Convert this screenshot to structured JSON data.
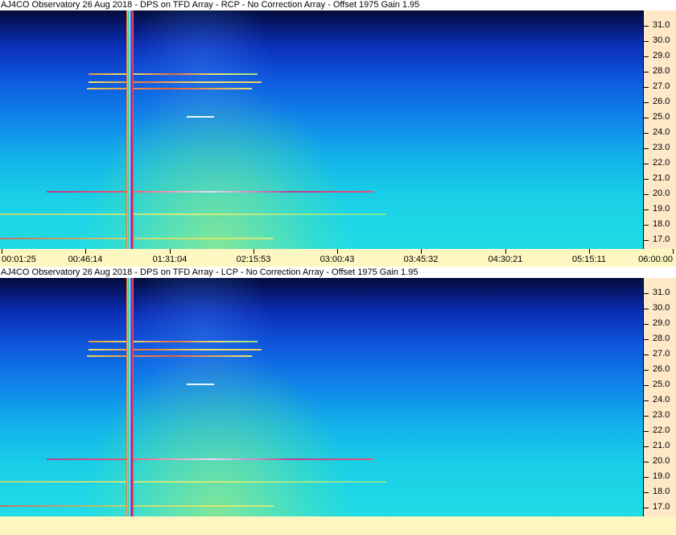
{
  "panels": [
    {
      "title": "AJ4CO Observatory 26 Aug 2018 - DPS on TFD Array  - RCP  -  No Correction Array  -  Offset 1975  Gain 1.95",
      "freq_labels": [
        "31.0",
        "30.0",
        "29.0",
        "28.0",
        "27.0",
        "26.0",
        "25.0",
        "24.0",
        "23.0",
        "22.0",
        "21.0",
        "20.0",
        "19.0",
        "18.0",
        "17.0"
      ]
    },
    {
      "title": "AJ4CO Observatory 26 Aug 2018 - DPS on TFD Array  - LCP  -  No Correction Array  -  Offset 1975  Gain 1.95",
      "freq_labels": [
        "31.0",
        "30.0",
        "29.0",
        "28.0",
        "27.0",
        "26.0",
        "25.0",
        "24.0",
        "23.0",
        "22.0",
        "21.0",
        "20.0",
        "19.0",
        "18.0",
        "17.0"
      ]
    }
  ],
  "time_axis": {
    "labels": [
      "00:01:25",
      "00:46:14",
      "01:31:04",
      "02:15:53",
      "03:00:43",
      "03:45:32",
      "04:30:21",
      "05:15:11",
      "06:00:00"
    ]
  },
  "colors": {
    "freq_axis_bg": "#ffe8c8",
    "time_axis_bg": "#fff7c2",
    "interference_stripe": "rainbow"
  }
}
